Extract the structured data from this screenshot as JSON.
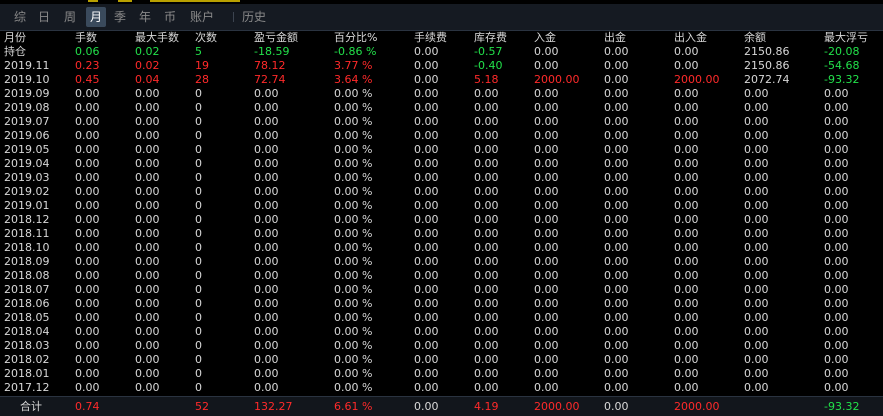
{
  "tabs": [
    {
      "label": "综",
      "active": false
    },
    {
      "label": "日",
      "active": false
    },
    {
      "label": "周",
      "active": false
    },
    {
      "label": "月",
      "active": true
    },
    {
      "label": "季",
      "active": false
    },
    {
      "label": "年",
      "active": false
    },
    {
      "label": "币",
      "active": false
    },
    {
      "label": "账户",
      "active": false
    },
    {
      "label": "历史",
      "active": false
    }
  ],
  "columns": [
    "月份",
    "手数",
    "最大手数",
    "次数",
    "盈亏金额",
    "百分比%",
    "手续费",
    "库存费",
    "入金",
    "出金",
    "出入金",
    "余额",
    "最大浮亏"
  ],
  "colors": {
    "red": "#ff2a2a",
    "green": "#22e04a",
    "white": "#d8d8d8"
  },
  "rows": [
    {
      "cells": [
        "持仓",
        "0.06",
        "0.02",
        "5",
        "-18.59",
        "-0.86 %",
        "0.00",
        "-0.57",
        "0.00",
        "0.00",
        "0.00",
        "2150.86",
        "-20.08"
      ],
      "colors": [
        "w",
        "g",
        "g",
        "g",
        "g",
        "g",
        "w",
        "g",
        "w",
        "w",
        "w",
        "w",
        "g"
      ]
    },
    {
      "cells": [
        "2019.11",
        "0.23",
        "0.02",
        "19",
        "78.12",
        "3.77 %",
        "0.00",
        "-0.40",
        "0.00",
        "0.00",
        "0.00",
        "2150.86",
        "-54.68"
      ],
      "colors": [
        "w",
        "r",
        "r",
        "r",
        "r",
        "r",
        "w",
        "g",
        "w",
        "w",
        "w",
        "w",
        "g"
      ]
    },
    {
      "cells": [
        "2019.10",
        "0.45",
        "0.04",
        "28",
        "72.74",
        "3.64 %",
        "0.00",
        "5.18",
        "2000.00",
        "0.00",
        "2000.00",
        "2072.74",
        "-93.32"
      ],
      "colors": [
        "w",
        "r",
        "r",
        "r",
        "r",
        "r",
        "w",
        "r",
        "r",
        "w",
        "r",
        "w",
        "g"
      ]
    },
    {
      "cells": [
        "2019.09",
        "0.00",
        "0.00",
        "0",
        "0.00",
        "0.00 %",
        "0.00",
        "0.00",
        "0.00",
        "0.00",
        "0.00",
        "0.00",
        "0.00"
      ]
    },
    {
      "cells": [
        "2019.08",
        "0.00",
        "0.00",
        "0",
        "0.00",
        "0.00 %",
        "0.00",
        "0.00",
        "0.00",
        "0.00",
        "0.00",
        "0.00",
        "0.00"
      ]
    },
    {
      "cells": [
        "2019.07",
        "0.00",
        "0.00",
        "0",
        "0.00",
        "0.00 %",
        "0.00",
        "0.00",
        "0.00",
        "0.00",
        "0.00",
        "0.00",
        "0.00"
      ]
    },
    {
      "cells": [
        "2019.06",
        "0.00",
        "0.00",
        "0",
        "0.00",
        "0.00 %",
        "0.00",
        "0.00",
        "0.00",
        "0.00",
        "0.00",
        "0.00",
        "0.00"
      ]
    },
    {
      "cells": [
        "2019.05",
        "0.00",
        "0.00",
        "0",
        "0.00",
        "0.00 %",
        "0.00",
        "0.00",
        "0.00",
        "0.00",
        "0.00",
        "0.00",
        "0.00"
      ]
    },
    {
      "cells": [
        "2019.04",
        "0.00",
        "0.00",
        "0",
        "0.00",
        "0.00 %",
        "0.00",
        "0.00",
        "0.00",
        "0.00",
        "0.00",
        "0.00",
        "0.00"
      ]
    },
    {
      "cells": [
        "2019.03",
        "0.00",
        "0.00",
        "0",
        "0.00",
        "0.00 %",
        "0.00",
        "0.00",
        "0.00",
        "0.00",
        "0.00",
        "0.00",
        "0.00"
      ]
    },
    {
      "cells": [
        "2019.02",
        "0.00",
        "0.00",
        "0",
        "0.00",
        "0.00 %",
        "0.00",
        "0.00",
        "0.00",
        "0.00",
        "0.00",
        "0.00",
        "0.00"
      ]
    },
    {
      "cells": [
        "2019.01",
        "0.00",
        "0.00",
        "0",
        "0.00",
        "0.00 %",
        "0.00",
        "0.00",
        "0.00",
        "0.00",
        "0.00",
        "0.00",
        "0.00"
      ]
    },
    {
      "cells": [
        "2018.12",
        "0.00",
        "0.00",
        "0",
        "0.00",
        "0.00 %",
        "0.00",
        "0.00",
        "0.00",
        "0.00",
        "0.00",
        "0.00",
        "0.00"
      ]
    },
    {
      "cells": [
        "2018.11",
        "0.00",
        "0.00",
        "0",
        "0.00",
        "0.00 %",
        "0.00",
        "0.00",
        "0.00",
        "0.00",
        "0.00",
        "0.00",
        "0.00"
      ]
    },
    {
      "cells": [
        "2018.10",
        "0.00",
        "0.00",
        "0",
        "0.00",
        "0.00 %",
        "0.00",
        "0.00",
        "0.00",
        "0.00",
        "0.00",
        "0.00",
        "0.00"
      ]
    },
    {
      "cells": [
        "2018.09",
        "0.00",
        "0.00",
        "0",
        "0.00",
        "0.00 %",
        "0.00",
        "0.00",
        "0.00",
        "0.00",
        "0.00",
        "0.00",
        "0.00"
      ]
    },
    {
      "cells": [
        "2018.08",
        "0.00",
        "0.00",
        "0",
        "0.00",
        "0.00 %",
        "0.00",
        "0.00",
        "0.00",
        "0.00",
        "0.00",
        "0.00",
        "0.00"
      ]
    },
    {
      "cells": [
        "2018.07",
        "0.00",
        "0.00",
        "0",
        "0.00",
        "0.00 %",
        "0.00",
        "0.00",
        "0.00",
        "0.00",
        "0.00",
        "0.00",
        "0.00"
      ]
    },
    {
      "cells": [
        "2018.06",
        "0.00",
        "0.00",
        "0",
        "0.00",
        "0.00 %",
        "0.00",
        "0.00",
        "0.00",
        "0.00",
        "0.00",
        "0.00",
        "0.00"
      ]
    },
    {
      "cells": [
        "2018.05",
        "0.00",
        "0.00",
        "0",
        "0.00",
        "0.00 %",
        "0.00",
        "0.00",
        "0.00",
        "0.00",
        "0.00",
        "0.00",
        "0.00"
      ]
    },
    {
      "cells": [
        "2018.04",
        "0.00",
        "0.00",
        "0",
        "0.00",
        "0.00 %",
        "0.00",
        "0.00",
        "0.00",
        "0.00",
        "0.00",
        "0.00",
        "0.00"
      ]
    },
    {
      "cells": [
        "2018.03",
        "0.00",
        "0.00",
        "0",
        "0.00",
        "0.00 %",
        "0.00",
        "0.00",
        "0.00",
        "0.00",
        "0.00",
        "0.00",
        "0.00"
      ]
    },
    {
      "cells": [
        "2018.02",
        "0.00",
        "0.00",
        "0",
        "0.00",
        "0.00 %",
        "0.00",
        "0.00",
        "0.00",
        "0.00",
        "0.00",
        "0.00",
        "0.00"
      ]
    },
    {
      "cells": [
        "2018.01",
        "0.00",
        "0.00",
        "0",
        "0.00",
        "0.00 %",
        "0.00",
        "0.00",
        "0.00",
        "0.00",
        "0.00",
        "0.00",
        "0.00"
      ]
    },
    {
      "cells": [
        "2017.12",
        "0.00",
        "0.00",
        "0",
        "0.00",
        "0.00 %",
        "0.00",
        "0.00",
        "0.00",
        "0.00",
        "0.00",
        "0.00",
        "0.00"
      ]
    }
  ],
  "total": {
    "cells": [
      "合计",
      "0.74",
      "",
      "52",
      "132.27",
      "6.61 %",
      "0.00",
      "4.19",
      "2000.00",
      "0.00",
      "2000.00",
      "",
      "-93.32"
    ],
    "colors": [
      "w",
      "r",
      "w",
      "r",
      "r",
      "r",
      "w",
      "r",
      "r",
      "w",
      "r",
      "w",
      "g"
    ]
  }
}
